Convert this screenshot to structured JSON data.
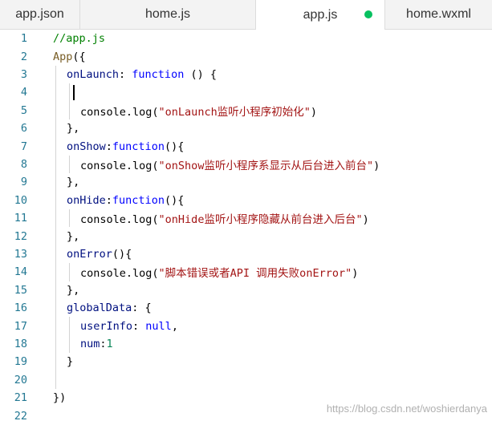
{
  "tabs": [
    {
      "label": "app.json",
      "active": false
    },
    {
      "label": "home.js",
      "active": false
    },
    {
      "label": "app.js",
      "active": true,
      "modified": true
    },
    {
      "label": "home.wxml",
      "active": false
    }
  ],
  "colors": {
    "modified_dot": "#07c160",
    "line_number": "#237893",
    "keyword": "#0000ff",
    "string": "#a31515",
    "comment": "#008000"
  },
  "editor": {
    "line_numbers": [
      "1",
      "2",
      "3",
      "4",
      "5",
      "6",
      "7",
      "8",
      "9",
      "10",
      "11",
      "12",
      "13",
      "14",
      "15",
      "16",
      "17",
      "18",
      "19",
      "20",
      "21",
      "22"
    ],
    "code": {
      "l1": "//app.js",
      "l2_fn": "App",
      "l2_p": "({",
      "l3_prop": "onLaunch",
      "l3_p": ": ",
      "l3_kw": "function",
      "l3_p2": " () {",
      "l5_a": "console.log(",
      "l5_s": "\"onLaunch监听小程序初始化\"",
      "l5_b": ")",
      "l6": "},",
      "l7_prop": "onShow",
      "l7_p": ":",
      "l7_kw": "function",
      "l7_p2": "(){",
      "l8_a": "console.log(",
      "l8_s": "\"onShow监听小程序系显示从后台进入前台\"",
      "l8_b": ")",
      "l9": "},",
      "l10_prop": "onHide",
      "l10_p": ":",
      "l10_kw": "function",
      "l10_p2": "(){",
      "l11_a": "console.log(",
      "l11_s": "\"onHide监听小程序隐藏从前台进入后台\"",
      "l11_b": ")",
      "l12": "},",
      "l13_prop": "onError",
      "l13_p": "(){",
      "l14_a": "console.log(",
      "l14_s": "\"脚本错误或者API 调用失败onError\"",
      "l14_b": ")",
      "l15": "},",
      "l16_prop": "globalData",
      "l16_p": ": {",
      "l17_prop": "userInfo",
      "l17_p": ": ",
      "l17_kw": "null",
      "l17_p2": ",",
      "l18_prop": "num",
      "l18_p": ":",
      "l18_num": "1",
      "l19": "}",
      "l21": "})"
    }
  },
  "watermark": "https://blog.csdn.net/woshierdanya"
}
